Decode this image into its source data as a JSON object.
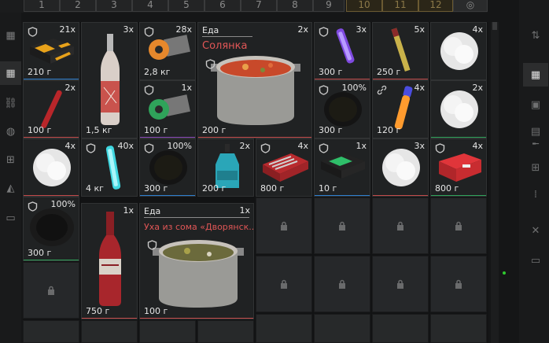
{
  "topbar": {
    "tabs": [
      "1",
      "2",
      "3",
      "4",
      "5",
      "6",
      "7",
      "8",
      "9",
      "10",
      "11",
      "12",
      "◎"
    ]
  },
  "grid": {
    "items": [
      {
        "id": "box",
        "count": "21x",
        "weight": "210 г",
        "badge": "shield",
        "underline": "#2e7fd0"
      },
      {
        "id": "bottle",
        "count": "3x",
        "weight": "1,5 кг",
        "badge": "",
        "underline": ""
      },
      {
        "id": "tool1",
        "count": "28x",
        "weight": "2,8 кг",
        "badge": "shield",
        "underline": ""
      },
      {
        "id": "pot1",
        "title": "Еда",
        "name": "Солянка",
        "count": "2x",
        "weight": "200 г",
        "badge": "shield",
        "underline": "#c24a4a"
      },
      {
        "id": "glow1",
        "count": "3x",
        "weight": "300 г",
        "badge": "shield",
        "underline": "#c24a4a"
      },
      {
        "id": "flare",
        "count": "5x",
        "weight": "250 г",
        "badge": "",
        "underline": "#c24a4a"
      },
      {
        "id": "smoke1",
        "count": "4x",
        "weight": "",
        "badge": "",
        "underline": ""
      },
      {
        "id": "stick",
        "count": "2x",
        "weight": "100 г",
        "badge": "",
        "underline": "#c24a4a"
      },
      {
        "id": "tool2",
        "count": "1x",
        "weight": "100 г",
        "badge": "shield",
        "underline": "#8a48b8"
      },
      {
        "id": "charcoal1",
        "count": "100%",
        "weight": "300 г",
        "badge": "shield",
        "underline": ""
      },
      {
        "id": "glow2",
        "count": "4x",
        "weight": "120 г",
        "badge": "link",
        "underline": ""
      },
      {
        "id": "smoke2",
        "count": "2x",
        "weight": "",
        "badge": "",
        "underline": "#2fa35a"
      },
      {
        "id": "smoke3",
        "count": "4x",
        "weight": "",
        "badge": "",
        "underline": "#c24a4a"
      },
      {
        "id": "glow3",
        "count": "40x",
        "weight": "4 кг",
        "badge": "shield",
        "underline": ""
      },
      {
        "id": "charcoal2",
        "count": "100%",
        "weight": "300 г",
        "badge": "shield",
        "underline": "#2e7fd0"
      },
      {
        "id": "spray",
        "count": "2x",
        "weight": "200 г",
        "badge": "",
        "underline": ""
      },
      {
        "id": "redcase",
        "count": "4x",
        "weight": "800 г",
        "badge": "shield",
        "underline": ""
      },
      {
        "id": "greencase",
        "count": "1x",
        "weight": "10 г",
        "badge": "shield",
        "underline": "#2e7fd0"
      },
      {
        "id": "smoke4",
        "count": "3x",
        "weight": "",
        "badge": "",
        "underline": "#c24a4a"
      },
      {
        "id": "medbox",
        "count": "4x",
        "weight": "800 г",
        "badge": "shield",
        "underline": "#2fa35a"
      },
      {
        "id": "charcoal3",
        "count": "100%",
        "weight": "300 г",
        "badge": "shield",
        "underline": "#2fa35a"
      },
      {
        "id": "wine",
        "count": "1x",
        "weight": "750 г",
        "badge": "",
        "underline": "#c24a4a"
      },
      {
        "id": "pot2",
        "title": "Еда",
        "name": "Уха из сома «Дворянск...",
        "count": "1x",
        "weight": "100 г",
        "badge": "shield",
        "underline": "#c24a4a"
      }
    ]
  },
  "colors": {
    "background": "#151617",
    "cell": "#27292a",
    "accent": "#c8a85a",
    "warning": "#e05656"
  }
}
